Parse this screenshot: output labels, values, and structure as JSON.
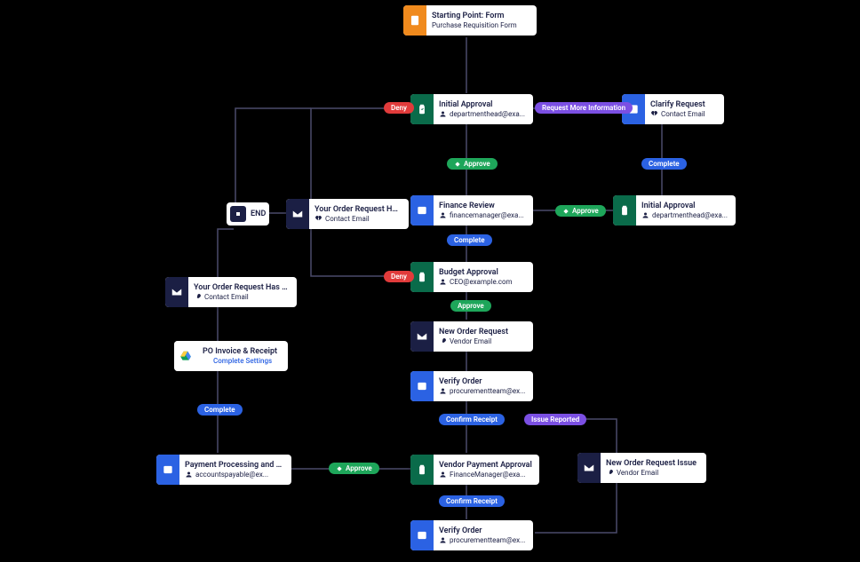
{
  "nodes": {
    "start": {
      "title": "Starting Point: Form",
      "sub": "Purchase Requisition Form"
    },
    "initial_approval": {
      "title": "Initial Approval",
      "sub": "departmenthead@exa..."
    },
    "clarify": {
      "title": "Clarify Request",
      "sub": "Contact Email"
    },
    "initial_approval2": {
      "title": "Initial Approval",
      "sub": "departmenthead@exa..."
    },
    "finance_review": {
      "title": "Finance Review",
      "sub": "financemanager@exa..."
    },
    "order_request_bounced": {
      "title": "Your Order Request Has Bee...",
      "sub": "Contact Email"
    },
    "budget_approval": {
      "title": "Budget Approval",
      "sub": "CEO@example.com"
    },
    "order_request_sent": {
      "title": "Your Order Request Has Bee...",
      "sub": "Contact Email"
    },
    "new_order": {
      "title": "New Order Request",
      "sub": "Vendor Email"
    },
    "po_invoice": {
      "title": "PO Invoice & Receipt",
      "sub": "Complete Settings"
    },
    "verify_order": {
      "title": "Verify Order",
      "sub": "procurementteam@ex..."
    },
    "payment_processing": {
      "title": "Payment Processing and Co...",
      "sub": "accountspayable@ex..."
    },
    "vendor_payment": {
      "title": "Vendor Payment Approval",
      "sub": "FinanceManager@exa..."
    },
    "order_issue": {
      "title": "New Order Request Issue",
      "sub": "Vendor Email"
    },
    "verify_order2": {
      "title": "Verify Order",
      "sub": "procurementteam@ex..."
    },
    "end": {
      "label": "END"
    }
  },
  "pills": {
    "deny1": "Deny",
    "request_info": "Request More Information",
    "approve1": "Approve",
    "complete1": "Complete",
    "approve2": "Approve",
    "complete2": "Complete",
    "deny2": "Deny",
    "approve3": "Approve",
    "complete3": "Complete",
    "confirm1": "Confirm Receipt",
    "issue_reported": "Issue Reported",
    "approve4": "Approve",
    "confirm2": "Confirm Receipt"
  }
}
